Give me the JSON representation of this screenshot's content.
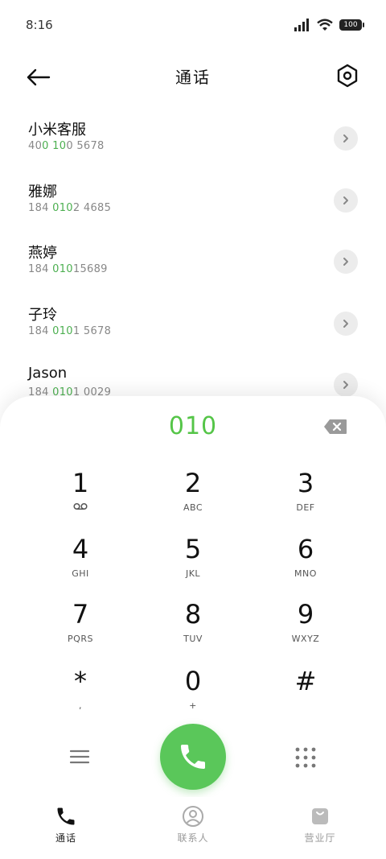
{
  "status": {
    "time": "8:16",
    "battery": "100"
  },
  "header": {
    "title": "通话"
  },
  "contacts": [
    {
      "name": "小米客服",
      "number_pre": "40",
      "number_hl": "0 10",
      "number_post": "0 5678"
    },
    {
      "name": "雅娜",
      "number_pre": "184 ",
      "number_hl": "010",
      "number_post": "2 4685"
    },
    {
      "name": "燕婷",
      "number_pre": "184 ",
      "number_hl": "010",
      "number_post": "15689"
    },
    {
      "name": "子玲",
      "number_pre": "184 ",
      "number_hl": "010",
      "number_post": "1 5678"
    },
    {
      "name": "Jason",
      "number_pre": "184 ",
      "number_hl": "010",
      "number_post": "1 0029"
    }
  ],
  "dialer": {
    "input": "010",
    "keys": [
      {
        "digit": "1",
        "letters": ""
      },
      {
        "digit": "2",
        "letters": "ABC"
      },
      {
        "digit": "3",
        "letters": "DEF"
      },
      {
        "digit": "4",
        "letters": "GHI"
      },
      {
        "digit": "5",
        "letters": "JKL"
      },
      {
        "digit": "6",
        "letters": "MNO"
      },
      {
        "digit": "7",
        "letters": "PQRS"
      },
      {
        "digit": "8",
        "letters": "TUV"
      },
      {
        "digit": "9",
        "letters": "WXYZ"
      },
      {
        "digit": "*",
        "letters": ","
      },
      {
        "digit": "0",
        "letters": "+"
      },
      {
        "digit": "#",
        "letters": ""
      }
    ]
  },
  "nav": {
    "calls": "通话",
    "contacts": "联系人",
    "store": "营业厅"
  },
  "colors": {
    "accent": "#55c548",
    "call_button": "#5ac75a"
  }
}
